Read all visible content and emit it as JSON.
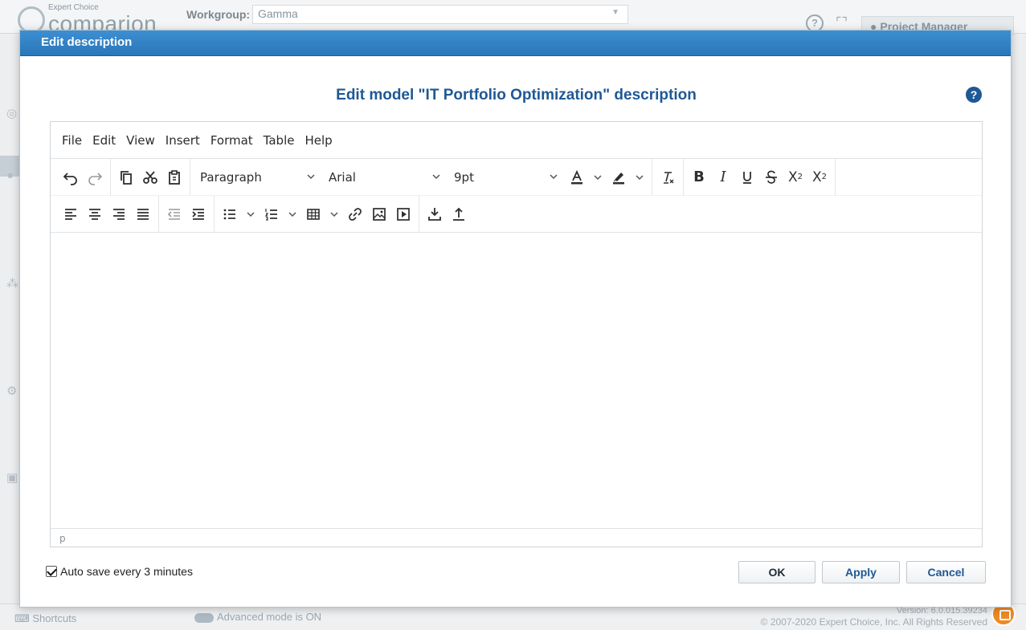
{
  "app": {
    "logo_small": "Expert Choice",
    "logo_big": "comparion",
    "workgroup_label": "Workgroup:",
    "workgroup_value": "Gamma",
    "user_menu": "Project Manager",
    "help_icon": "?",
    "fullscreen_icon": "⌜⌝"
  },
  "footer": {
    "shortcuts": "Shortcuts",
    "advanced_mode": "Advanced mode is ON",
    "version": "Version: 6.0.015.39234",
    "copyright": "© 2007-2020 Expert Choice, Inc. All Rights Reserved"
  },
  "modal": {
    "title": "Edit description",
    "heading": "Edit model \"IT Portfolio Optimization\" description",
    "help_icon": "?",
    "menubar": [
      "File",
      "Edit",
      "View",
      "Insert",
      "Format",
      "Table",
      "Help"
    ],
    "block_format": "Paragraph",
    "font_family": "Arial",
    "font_size": "9pt",
    "status_path": "p",
    "autosave_label": "Auto save every 3 minutes",
    "autosave_checked": true,
    "ok_label": "OK",
    "apply_label": "Apply",
    "cancel_label": "Cancel",
    "colors": {
      "titlebar": "#2f7fc1",
      "heading": "#1f5896",
      "button_text": "#1f5896",
      "chat_button": "#ef8a24"
    }
  }
}
